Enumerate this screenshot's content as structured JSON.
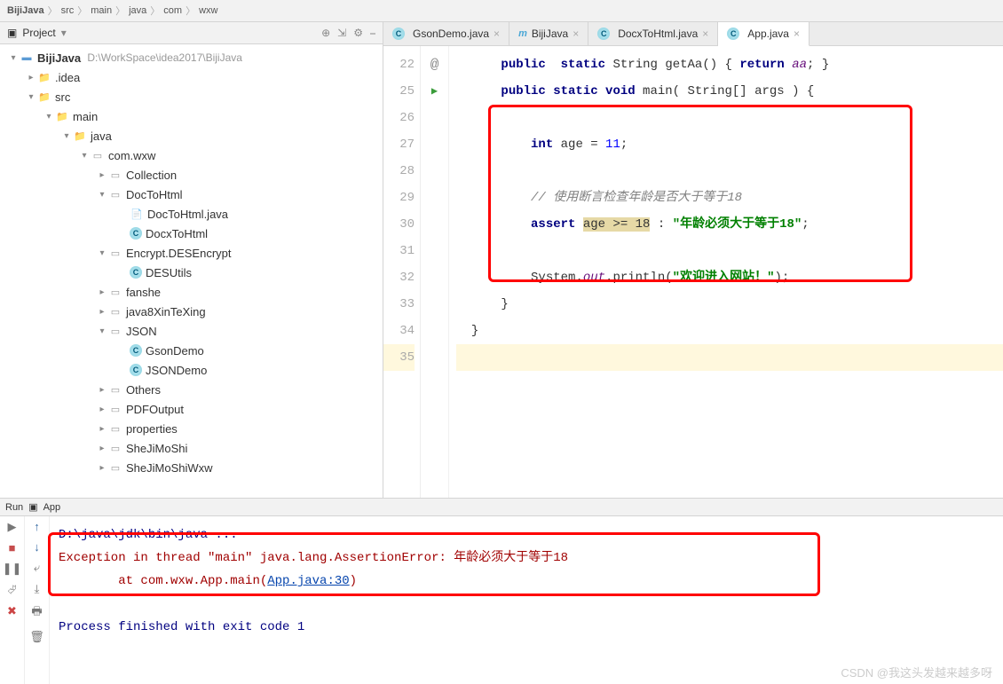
{
  "breadcrumb": [
    "BijiJava",
    "src",
    "main",
    "java",
    "com",
    "wxw"
  ],
  "project": {
    "label": "Project"
  },
  "root": {
    "name": "BijiJava",
    "path": "D:\\WorkSpace\\idea2017\\BijiJava"
  },
  "tree": {
    "idea": ".idea",
    "src": "src",
    "main": "main",
    "java": "java",
    "comwxw": "com.wxw",
    "collection": "Collection",
    "doctohtml": "DocToHtml",
    "doctohtmljava": "DocToHtml.java",
    "docxtohtml": "DocxToHtml",
    "encrypt": "Encrypt.DESEncrypt",
    "desutils": "DESUtils",
    "fanshe": "fanshe",
    "java8": "java8XinTeXing",
    "json": "JSON",
    "gsondemo": "GsonDemo",
    "jsondemo": "JSONDemo",
    "others": "Others",
    "pdfoutput": "PDFOutput",
    "properties": "properties",
    "shejimoshi": "SheJiMoShi",
    "shejimoshiwxw": "SheJiMoShiWxw"
  },
  "tabs": {
    "gson": "GsonDemo.java",
    "biji": "BijiJava",
    "docx": "DocxToHtml.java",
    "app": "App.java"
  },
  "gutter": {
    "l22": "22",
    "l25": "25",
    "l26": "26",
    "l27": "27",
    "l28": "28",
    "l29": "29",
    "l30": "30",
    "l31": "31",
    "l32": "32",
    "l33": "33",
    "l34": "34",
    "l35": "35"
  },
  "code": {
    "l22a": "public",
    "l22b": "static",
    "l22c": "String",
    "l22d": "getAa",
    "l22e": "()",
    "l22f": "{",
    "l22g": "return",
    "l22h": "aa",
    "l22i": ";",
    "l22j": "}",
    "l25a": "public static void",
    "l25b": " main",
    "l25c": "( String[] args ) {",
    "l27a": "int",
    "l27b": " age = ",
    "l27c": "11",
    "l27d": ";",
    "l29": "// 使用断言检查年龄是否大于等于18",
    "l30a": "assert",
    "l30b": " ",
    "l30c": "age >= 18",
    "l30d": " : ",
    "l30e": "\"年龄必须大于等于18\"",
    "l30f": ";",
    "l32a": "System.",
    "l32b": "out",
    "l32c": ".println(",
    "l32d": "\"欢迎进入网站！\"",
    "l32e": ");",
    "l33": "}",
    "l34": "}"
  },
  "run": {
    "label": "Run",
    "app": "App",
    "cmd": "D:\\java\\jdk\\bin\\java ...",
    "exc": "Exception in thread \"main\" java.lang.AssertionError: 年龄必须大于等于18",
    "at_prefix": "\tat com.wxw.App.main(",
    "at_link": "App.java:30",
    "at_suffix": ")",
    "exit": "Process finished with exit code 1"
  },
  "watermark": "CSDN @我这头发越来越多呀"
}
